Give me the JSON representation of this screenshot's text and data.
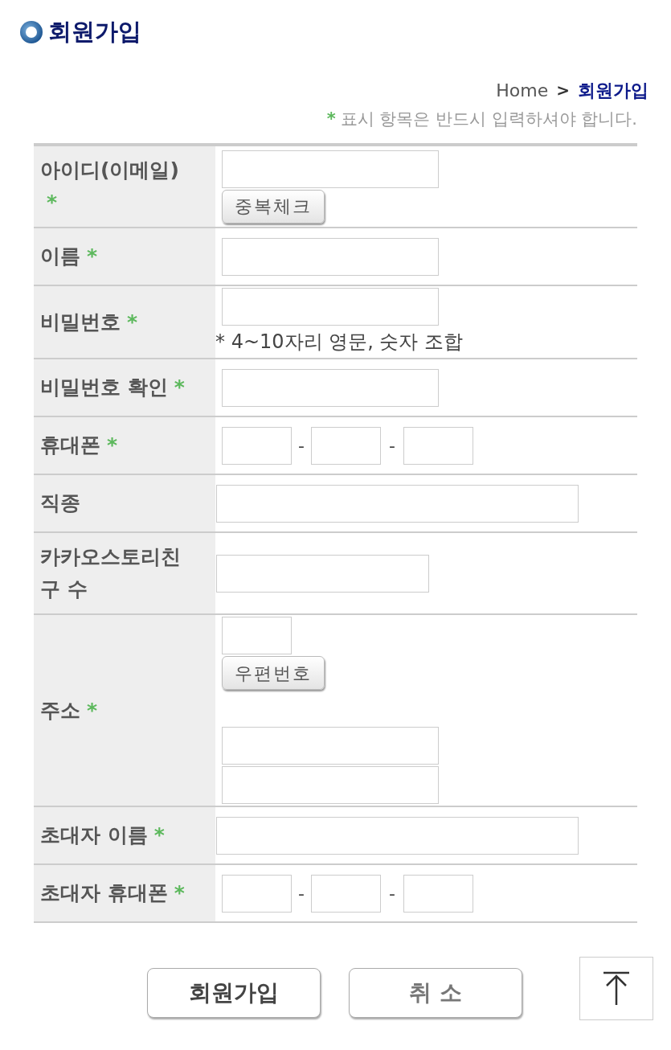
{
  "header": {
    "title": "회원가입"
  },
  "breadcrumb": {
    "items": [
      {
        "text": "Home",
        "current": false
      },
      {
        "text": ">",
        "current": false
      },
      {
        "text": "회원가입",
        "current": true
      }
    ]
  },
  "required_note": {
    "mark": "*",
    "text": "표시 항목은 반드시 입력하셔야 합니다."
  },
  "form": {
    "rows": [
      {
        "label": "아이디(이메일)",
        "mark": "*",
        "fields": [
          {
            "kind": "input"
          },
          {
            "kind": "button",
            "text": "중복체크"
          }
        ]
      },
      {
        "label": "이름",
        "mark": "*",
        "fields": [
          {
            "kind": "input"
          }
        ]
      },
      {
        "label": "비밀번호",
        "mark": "*",
        "fields": [
          {
            "kind": "input"
          },
          {
            "kind": "note",
            "text": "* 4~10자리 영문, 숫자 조합"
          }
        ]
      },
      {
        "label": "비밀번호 확인",
        "mark": "*",
        "fields": [
          {
            "kind": "input"
          }
        ]
      },
      {
        "label": "휴대폰",
        "mark": "*",
        "fields": [
          {
            "kind": "phone",
            "parts": [
              "-",
              "-"
            ]
          }
        ]
      },
      {
        "label": "직종",
        "fields": [
          {
            "kind": "longinput"
          }
        ]
      },
      {
        "label": "카카오스토리친구 수",
        "fields": [
          {
            "kind": "wideinput"
          }
        ]
      },
      {
        "label": "주소",
        "mark": "*",
        "fields": [
          {
            "kind": "zipinput"
          },
          {
            "kind": "button",
            "text": "우편번호"
          },
          {
            "kind": "input"
          },
          {
            "kind": "input"
          }
        ]
      },
      {
        "label": "초대자 이름",
        "mark": "*",
        "fields": [
          {
            "kind": "longinput"
          }
        ]
      },
      {
        "label": "초대자 휴대폰",
        "mark": "*",
        "fields": [
          {
            "kind": "phone",
            "parts": [
              "-",
              "-"
            ]
          }
        ]
      }
    ]
  },
  "actions": [
    {
      "text": "회원가입"
    },
    {
      "text": "취 소"
    }
  ],
  "top_button": {
    "kind": "top"
  }
}
